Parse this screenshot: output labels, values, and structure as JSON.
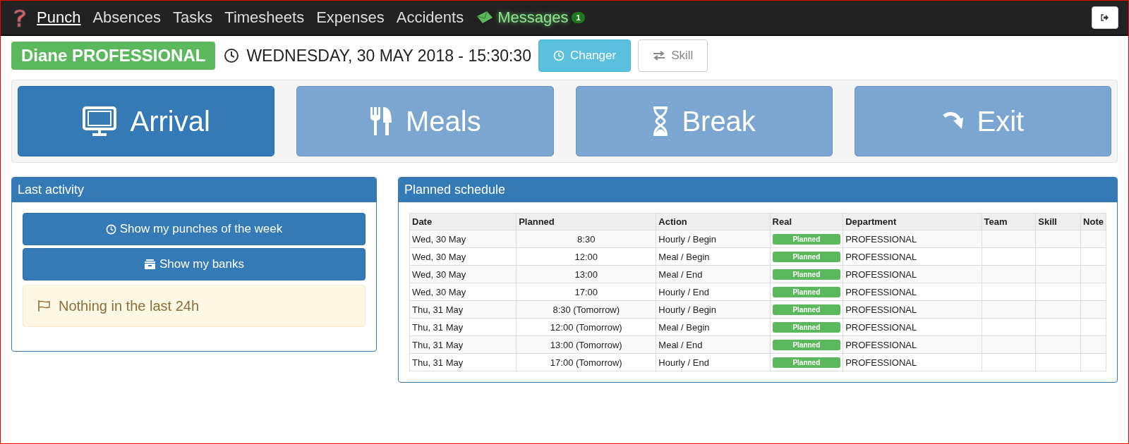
{
  "nav": {
    "items": [
      {
        "label": "Punch",
        "kind": "link",
        "selected": true
      },
      {
        "label": "Absences",
        "kind": "link",
        "selected": false
      },
      {
        "label": "Tasks",
        "kind": "link",
        "selected": false
      },
      {
        "label": "Timesheets",
        "kind": "link",
        "selected": false
      },
      {
        "label": "Expenses",
        "kind": "link",
        "selected": false
      },
      {
        "label": "Accidents",
        "kind": "link",
        "selected": false
      },
      {
        "label": "Messages",
        "kind": "messages",
        "selected": false,
        "badge": "1"
      }
    ]
  },
  "header": {
    "user": "Diane PROFESSIONAL",
    "datetime": "WEDNESDAY, 30 MAY 2018 - 15:30:30",
    "buttons": [
      {
        "label": "Changer",
        "kind": "clock",
        "disabled": false
      },
      {
        "label": "Skill",
        "kind": "swap",
        "disabled": true
      }
    ]
  },
  "punch_buttons": [
    {
      "label": "Arrival",
      "kind": "monitor",
      "selected": true
    },
    {
      "label": "Meals",
      "kind": "cutlery",
      "selected": false
    },
    {
      "label": "Break",
      "kind": "hourglass",
      "selected": false
    },
    {
      "label": "Exit",
      "kind": "exit",
      "selected": false
    }
  ],
  "last_activity": {
    "title": "Last activity",
    "buttons": [
      {
        "label": "Show my punches of the week",
        "kind": "clock"
      },
      {
        "label": "Show my banks",
        "kind": "box"
      }
    ],
    "notice": "Nothing in the last 24h"
  },
  "planned_schedule": {
    "title": "Planned schedule",
    "columns": [
      "Date",
      "Planned",
      "Action",
      "Real",
      "Department",
      "Team",
      "Skill",
      "Note"
    ],
    "rows": [
      {
        "date": "Wed, 30 May",
        "planned": "8:30",
        "action": "Hourly / Begin",
        "real": "Planned",
        "department": "PROFESSIONAL"
      },
      {
        "date": "Wed, 30 May",
        "planned": "12:00",
        "action": "Meal / Begin",
        "real": "Planned",
        "department": "PROFESSIONAL"
      },
      {
        "date": "Wed, 30 May",
        "planned": "13:00",
        "action": "Meal / End",
        "real": "Planned",
        "department": "PROFESSIONAL"
      },
      {
        "date": "Wed, 30 May",
        "planned": "17:00",
        "action": "Hourly / End",
        "real": "Planned",
        "department": "PROFESSIONAL"
      },
      {
        "date": "Thu, 31 May",
        "planned": "8:30 (Tomorrow)",
        "action": "Hourly / Begin",
        "real": "Planned",
        "department": "PROFESSIONAL"
      },
      {
        "date": "Thu, 31 May",
        "planned": "12:00 (Tomorrow)",
        "action": "Meal / Begin",
        "real": "Planned",
        "department": "PROFESSIONAL"
      },
      {
        "date": "Thu, 31 May",
        "planned": "13:00 (Tomorrow)",
        "action": "Meal / End",
        "real": "Planned",
        "department": "PROFESSIONAL"
      },
      {
        "date": "Thu, 31 May",
        "planned": "17:00 (Tomorrow)",
        "action": "Hourly / End",
        "real": "Planned",
        "department": "PROFESSIONAL"
      }
    ]
  }
}
